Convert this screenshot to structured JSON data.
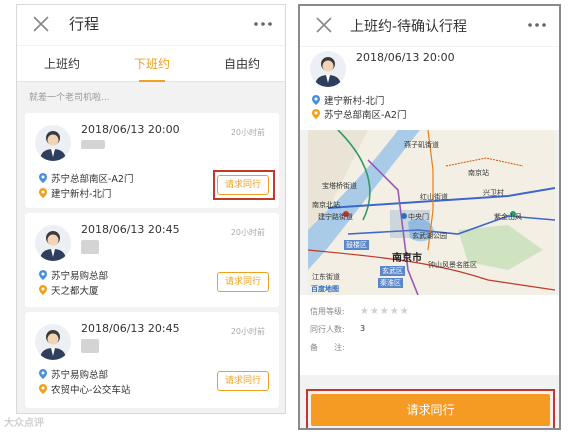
{
  "left_screen": {
    "title": "行程",
    "tabs": [
      {
        "label": "上班约",
        "active": false
      },
      {
        "label": "下班约",
        "active": true
      },
      {
        "label": "自由约",
        "active": false
      }
    ],
    "hint": "就差一个老司机啦...",
    "cards": [
      {
        "date": "2018/06/13 20:00",
        "ago": "20小时前",
        "from": "苏宁总部南区-A2门",
        "to": "建宁新村-北门",
        "button": "请求同行",
        "highlighted": true
      },
      {
        "date": "2018/06/13 20:45",
        "ago": "20小时前",
        "from": "苏宁易购总部",
        "to": "天之都大厦",
        "button": "请求同行",
        "highlighted": false
      },
      {
        "date": "2018/06/13 20:45",
        "ago": "20小时前",
        "from": "苏宁易购总部",
        "to": "农贸中心-公交车站",
        "button": "请求同行",
        "highlighted": false
      }
    ]
  },
  "right_screen": {
    "title": "上班约-待确认行程",
    "date": "2018/06/13 20:00",
    "from": "建宁新村-北门",
    "to": "苏宁总部南区-A2门",
    "map_labels": {
      "l1": "燕子矶街道",
      "l2": "宝塔桥街道",
      "l3": "南京站",
      "l4": "南京北站",
      "l5": "红山街道",
      "l6": "兴卫村",
      "l7": "建宁路街道",
      "l8": "中央门",
      "l9": "紫金山风",
      "l10": "玄武湖公园",
      "l11": "鼓楼区",
      "l12": "南京市",
      "l13": "玄武区",
      "l14": "钟山风景名胜区",
      "l15": "江东街道",
      "l16": "秦淮区",
      "l17": "百度地图"
    },
    "credit_label": "信用等级:",
    "credit_stars": "★★★★★",
    "people_label": "同行人数:",
    "people_value": "3",
    "note_label": "备　　注:",
    "button": "请求同行"
  },
  "watermark": "大众点评",
  "colors": {
    "accent": "#f0a020",
    "highlight": "#c0392b",
    "button": "#f59a23"
  }
}
